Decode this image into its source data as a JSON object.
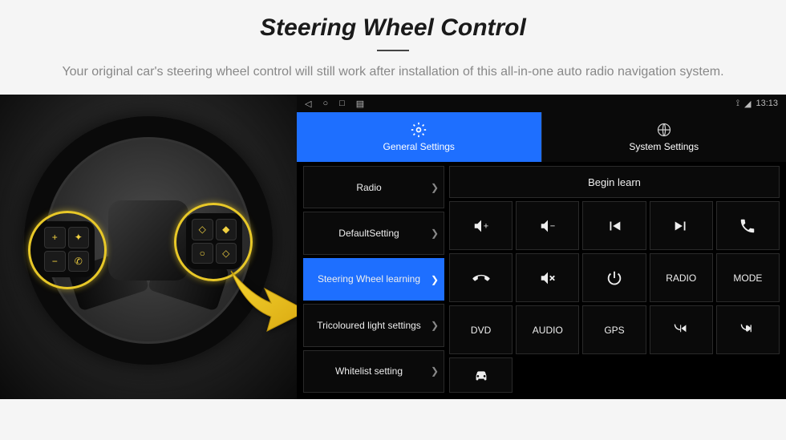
{
  "header": {
    "title": "Steering Wheel Control",
    "subtitle": "Your original car's steering wheel control will still work after installation of this all-in-one auto radio navigation system."
  },
  "statusbar": {
    "time": "13:13"
  },
  "tabs": {
    "general": "General Settings",
    "system": "System Settings"
  },
  "sidebar": {
    "items": [
      {
        "label": "Radio"
      },
      {
        "label": "DefaultSetting"
      },
      {
        "label": "Steering Wheel learning"
      },
      {
        "label": "Tricoloured light settings"
      },
      {
        "label": "Whitelist setting"
      }
    ]
  },
  "main": {
    "begin": "Begin learn",
    "buttons": {
      "radio": "RADIO",
      "mode": "MODE",
      "dvd": "DVD",
      "audio": "AUDIO",
      "gps": "GPS"
    }
  }
}
